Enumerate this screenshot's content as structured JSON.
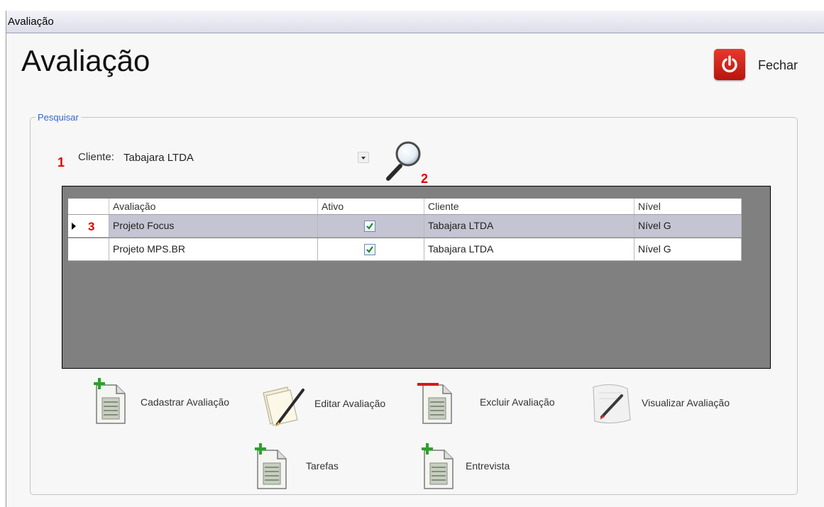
{
  "window": {
    "title": "Avaliação"
  },
  "header": {
    "title": "Avaliação",
    "close_label": "Fechar"
  },
  "search": {
    "group_label": "Pesquisar",
    "client_label": "Cliente:",
    "client_value": "Tabajara LTDA"
  },
  "annotations": {
    "a1": "1",
    "a2": "2",
    "a3": "3"
  },
  "grid": {
    "columns": [
      "Avaliação",
      "Ativo",
      "Cliente",
      "Nível"
    ],
    "rows": [
      {
        "avaliacao": "Projeto Focus",
        "ativo": true,
        "cliente": "Tabajara LTDA",
        "nivel": "Nível G",
        "selected": true
      },
      {
        "avaliacao": "Projeto MPS.BR",
        "ativo": true,
        "cliente": "Tabajara LTDA",
        "nivel": "Nível G",
        "selected": false
      }
    ]
  },
  "actions": {
    "cadastrar": "Cadastrar Avaliação",
    "editar": "Editar Avaliação",
    "excluir": "Excluir Avaliação",
    "visualizar": "Visualizar Avaliação",
    "tarefas": "Tarefas",
    "entrevista": "Entrevista"
  },
  "colors": {
    "selected_row": "#c4c4d3",
    "grid_background": "#808080",
    "close_button": "#d42418",
    "annotation": "#e00000",
    "group_label": "#3366cc"
  }
}
